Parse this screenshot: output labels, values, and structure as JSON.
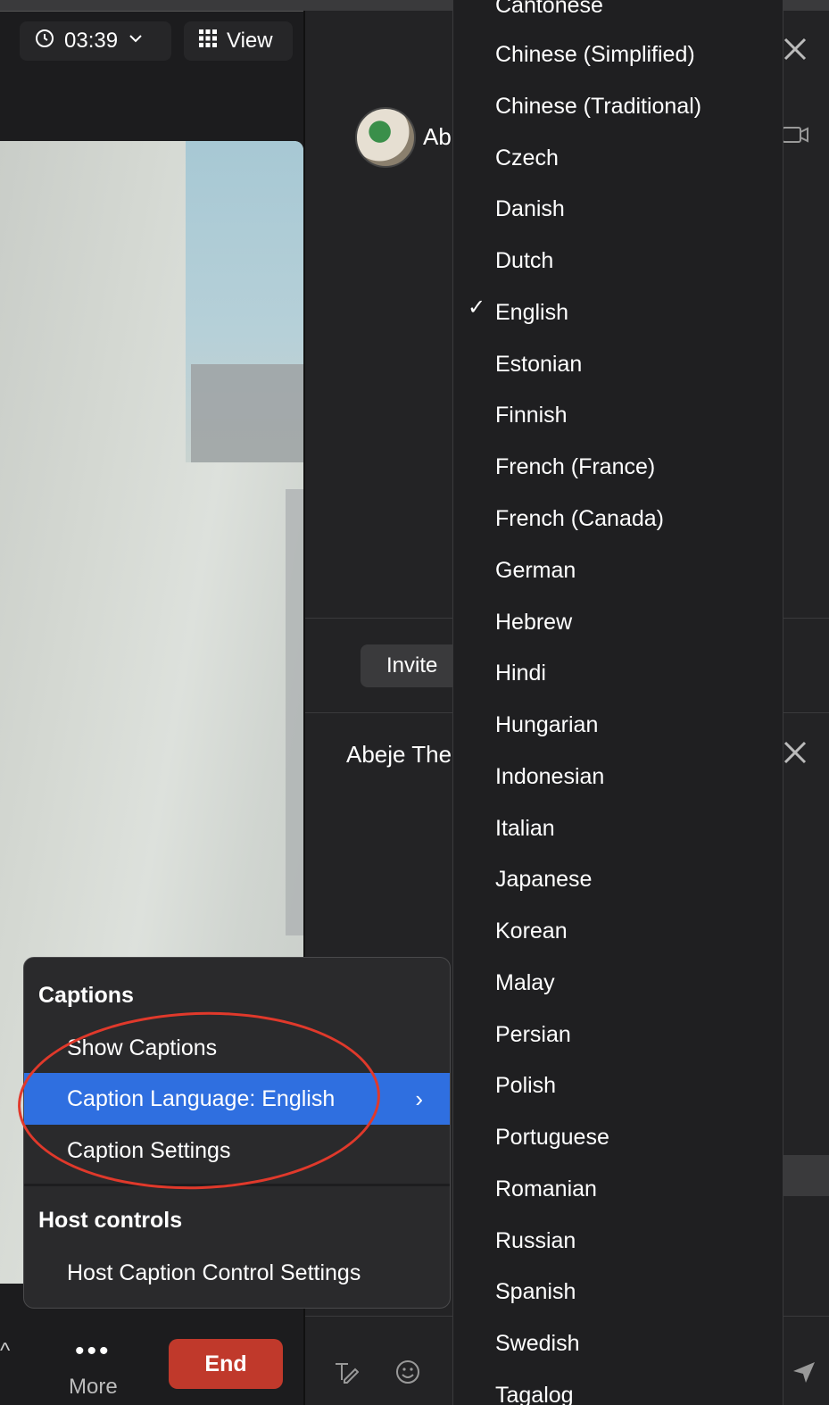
{
  "header": {
    "timer": "03:39",
    "view_label": "View"
  },
  "participants": {
    "name_partial": "Ab",
    "invite_label": "Invite"
  },
  "chat": {
    "recipient_partial": "Abeje The"
  },
  "toolbar": {
    "more_label": "More",
    "end_label": "End",
    "more_dots": "•••"
  },
  "captions_menu": {
    "heading": "Captions",
    "items": [
      "Show Captions",
      "Caption Language: English",
      "Caption Settings"
    ],
    "selected_index": 1,
    "host_heading": "Host controls",
    "host_items": [
      "Host Caption Control Settings"
    ]
  },
  "language_menu": {
    "selected": "English",
    "languages": [
      "Cantonese",
      "Chinese (Simplified)",
      "Chinese (Traditional)",
      "Czech",
      "Danish",
      "Dutch",
      "English",
      "Estonian",
      "Finnish",
      "French (France)",
      "French (Canada)",
      "German",
      "Hebrew",
      "Hindi",
      "Hungarian",
      "Indonesian",
      "Italian",
      "Japanese",
      "Korean",
      "Malay",
      "Persian",
      "Polish",
      "Portuguese",
      "Romanian",
      "Russian",
      "Spanish",
      "Swedish",
      "Tagalog"
    ]
  },
  "colors": {
    "highlight": "#2f6fe0",
    "end_button": "#c0392b",
    "annotation_oval": "#e0392b"
  }
}
